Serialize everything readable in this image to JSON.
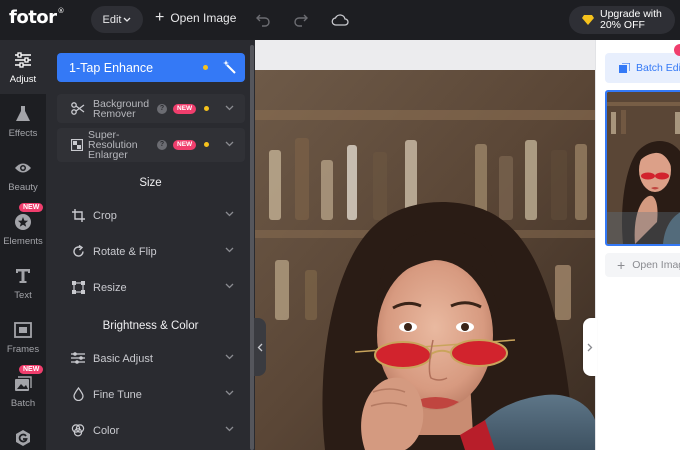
{
  "app": {
    "logo": "fotor",
    "logo_mark": "®"
  },
  "topbar": {
    "edit_label": "Edit",
    "open_image_label": "Open Image",
    "upgrade_line1": "Upgrade with",
    "upgrade_line2": "20% OFF"
  },
  "rail": {
    "items": [
      {
        "label": "Adjust",
        "icon": "sliders-icon",
        "active": true
      },
      {
        "label": "Effects",
        "icon": "flask-icon"
      },
      {
        "label": "Beauty",
        "icon": "eye-icon"
      },
      {
        "label": "Elements",
        "icon": "star-circle-icon",
        "badge": "NEW"
      },
      {
        "label": "Text",
        "icon": "text-t-icon"
      },
      {
        "label": "Frames",
        "icon": "frame-icon"
      },
      {
        "label": "Batch",
        "icon": "batch-images-icon",
        "badge": "NEW"
      },
      {
        "label": "",
        "icon": "g-logo-icon"
      }
    ]
  },
  "panel": {
    "one_tap": "1-Tap Enhance",
    "features": [
      {
        "label_line1": "Background",
        "label_line2": "Remover",
        "badge": "NEW"
      },
      {
        "label_line1": "Super-",
        "label_line2": "Resolution",
        "label_line3": "Enlarger",
        "badge": "NEW"
      }
    ],
    "size_title": "Size",
    "size_items": [
      "Crop",
      "Rotate & Flip",
      "Resize"
    ],
    "brightness_title": "Brightness & Color",
    "brightness_items": [
      "Basic Adjust",
      "Fine Tune",
      "Color"
    ]
  },
  "right_panel": {
    "batch_edit": "Batch Edit",
    "open_image": "Open Image"
  },
  "colors": {
    "accent": "#3479f6",
    "badge_pink": "#f03e6d",
    "premium_yellow": "#f6c21c",
    "dark_bg": "#1d1e22",
    "panel_bg": "#2a2b30"
  }
}
